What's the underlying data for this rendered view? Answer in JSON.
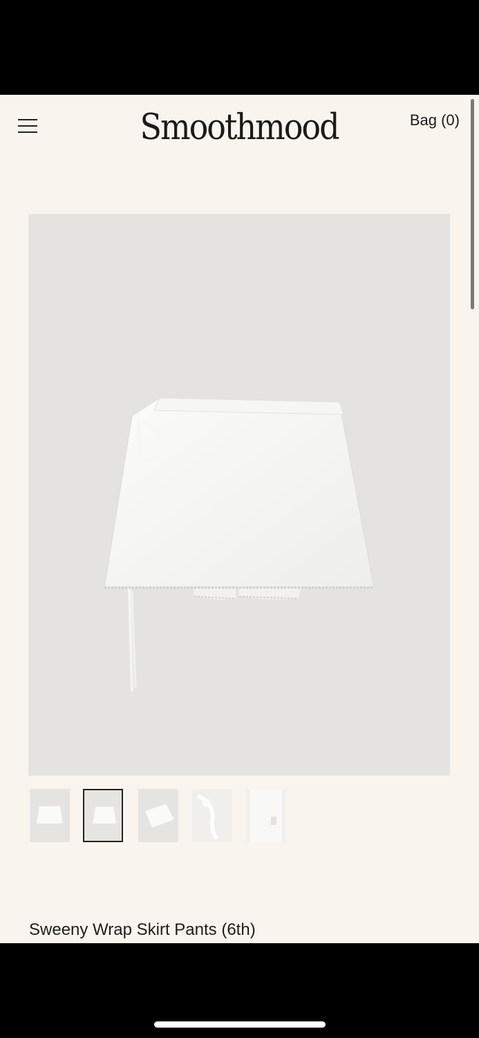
{
  "header": {
    "brand": "Smoothmood",
    "bag_label": "Bag (0)",
    "menu_icon": "hamburger-menu-icon"
  },
  "gallery": {
    "main_image": "white-wrap-skirt-photo",
    "thumbnails": [
      {
        "name": "thumbnail-front",
        "selected": false
      },
      {
        "name": "thumbnail-front-flat",
        "selected": true
      },
      {
        "name": "thumbnail-angle",
        "selected": false
      },
      {
        "name": "thumbnail-tie-detail",
        "selected": false
      },
      {
        "name": "thumbnail-side-detail",
        "selected": false
      }
    ]
  },
  "product": {
    "title": "Sweeny Wrap Skirt Pants (6th)"
  },
  "colors": {
    "background": "#f9f5ee",
    "photo_background": "#e4e3df",
    "text": "#1e1e1e"
  }
}
